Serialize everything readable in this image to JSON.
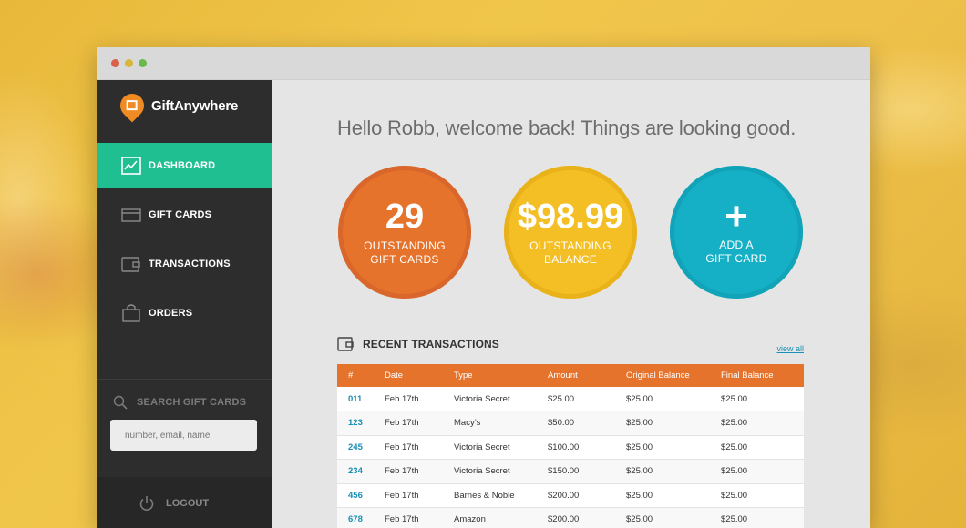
{
  "app": {
    "name_bold": "Gift",
    "name_rest": "Anywhere"
  },
  "sidebar": {
    "items": [
      {
        "label": "DASHBOARD",
        "icon": "chart-icon"
      },
      {
        "label": "GIFT CARDS",
        "icon": "card-icon"
      },
      {
        "label": "TRANSACTIONS",
        "icon": "wallet-icon"
      },
      {
        "label": "ORDERS",
        "icon": "bag-icon"
      }
    ],
    "search_label": "SEARCH GIFT CARDS",
    "search_placeholder": "number, email, name",
    "logout_label": "LOGOUT"
  },
  "main": {
    "greeting": "Hello Robb, welcome back!  Things are looking good.",
    "stats": [
      {
        "value": "29",
        "line1": "OUTSTANDING",
        "line2": "GIFT CARDS",
        "color": "#e5732b"
      },
      {
        "value": "$98.99",
        "line1": "OUTSTANDING",
        "line2": "BALANCE",
        "color": "#f4bf24"
      },
      {
        "value": "+",
        "line1": "ADD A",
        "line2": "GIFT CARD",
        "color": "#16b0c6"
      }
    ],
    "recent_title": "RECENT TRANSACTIONS",
    "view_all": "view all",
    "table": {
      "headers": [
        "#",
        "Date",
        "Type",
        "Amount",
        "Original Balance",
        "Final Balance"
      ],
      "rows": [
        [
          "011",
          "Feb 17th",
          "Victoria Secret",
          "$25.00",
          "$25.00",
          "$25.00"
        ],
        [
          "123",
          "Feb 17th",
          "Macy’s",
          "$50.00",
          "$25.00",
          "$25.00"
        ],
        [
          "245",
          "Feb 17th",
          "Victoria Secret",
          "$100.00",
          "$25.00",
          "$25.00"
        ],
        [
          "234",
          "Feb 17th",
          "Victoria Secret",
          "$150.00",
          "$25.00",
          "$25.00"
        ],
        [
          "456",
          "Feb 17th",
          "Barnes & Noble",
          "$200.00",
          "$25.00",
          "$25.00"
        ],
        [
          "678",
          "Feb 17th",
          "Amazon",
          "$200.00",
          "$25.00",
          "$25.00"
        ]
      ]
    }
  },
  "colors": {
    "accent": "#1fbf91",
    "orange": "#e5732b",
    "link": "#1b8fb5"
  }
}
